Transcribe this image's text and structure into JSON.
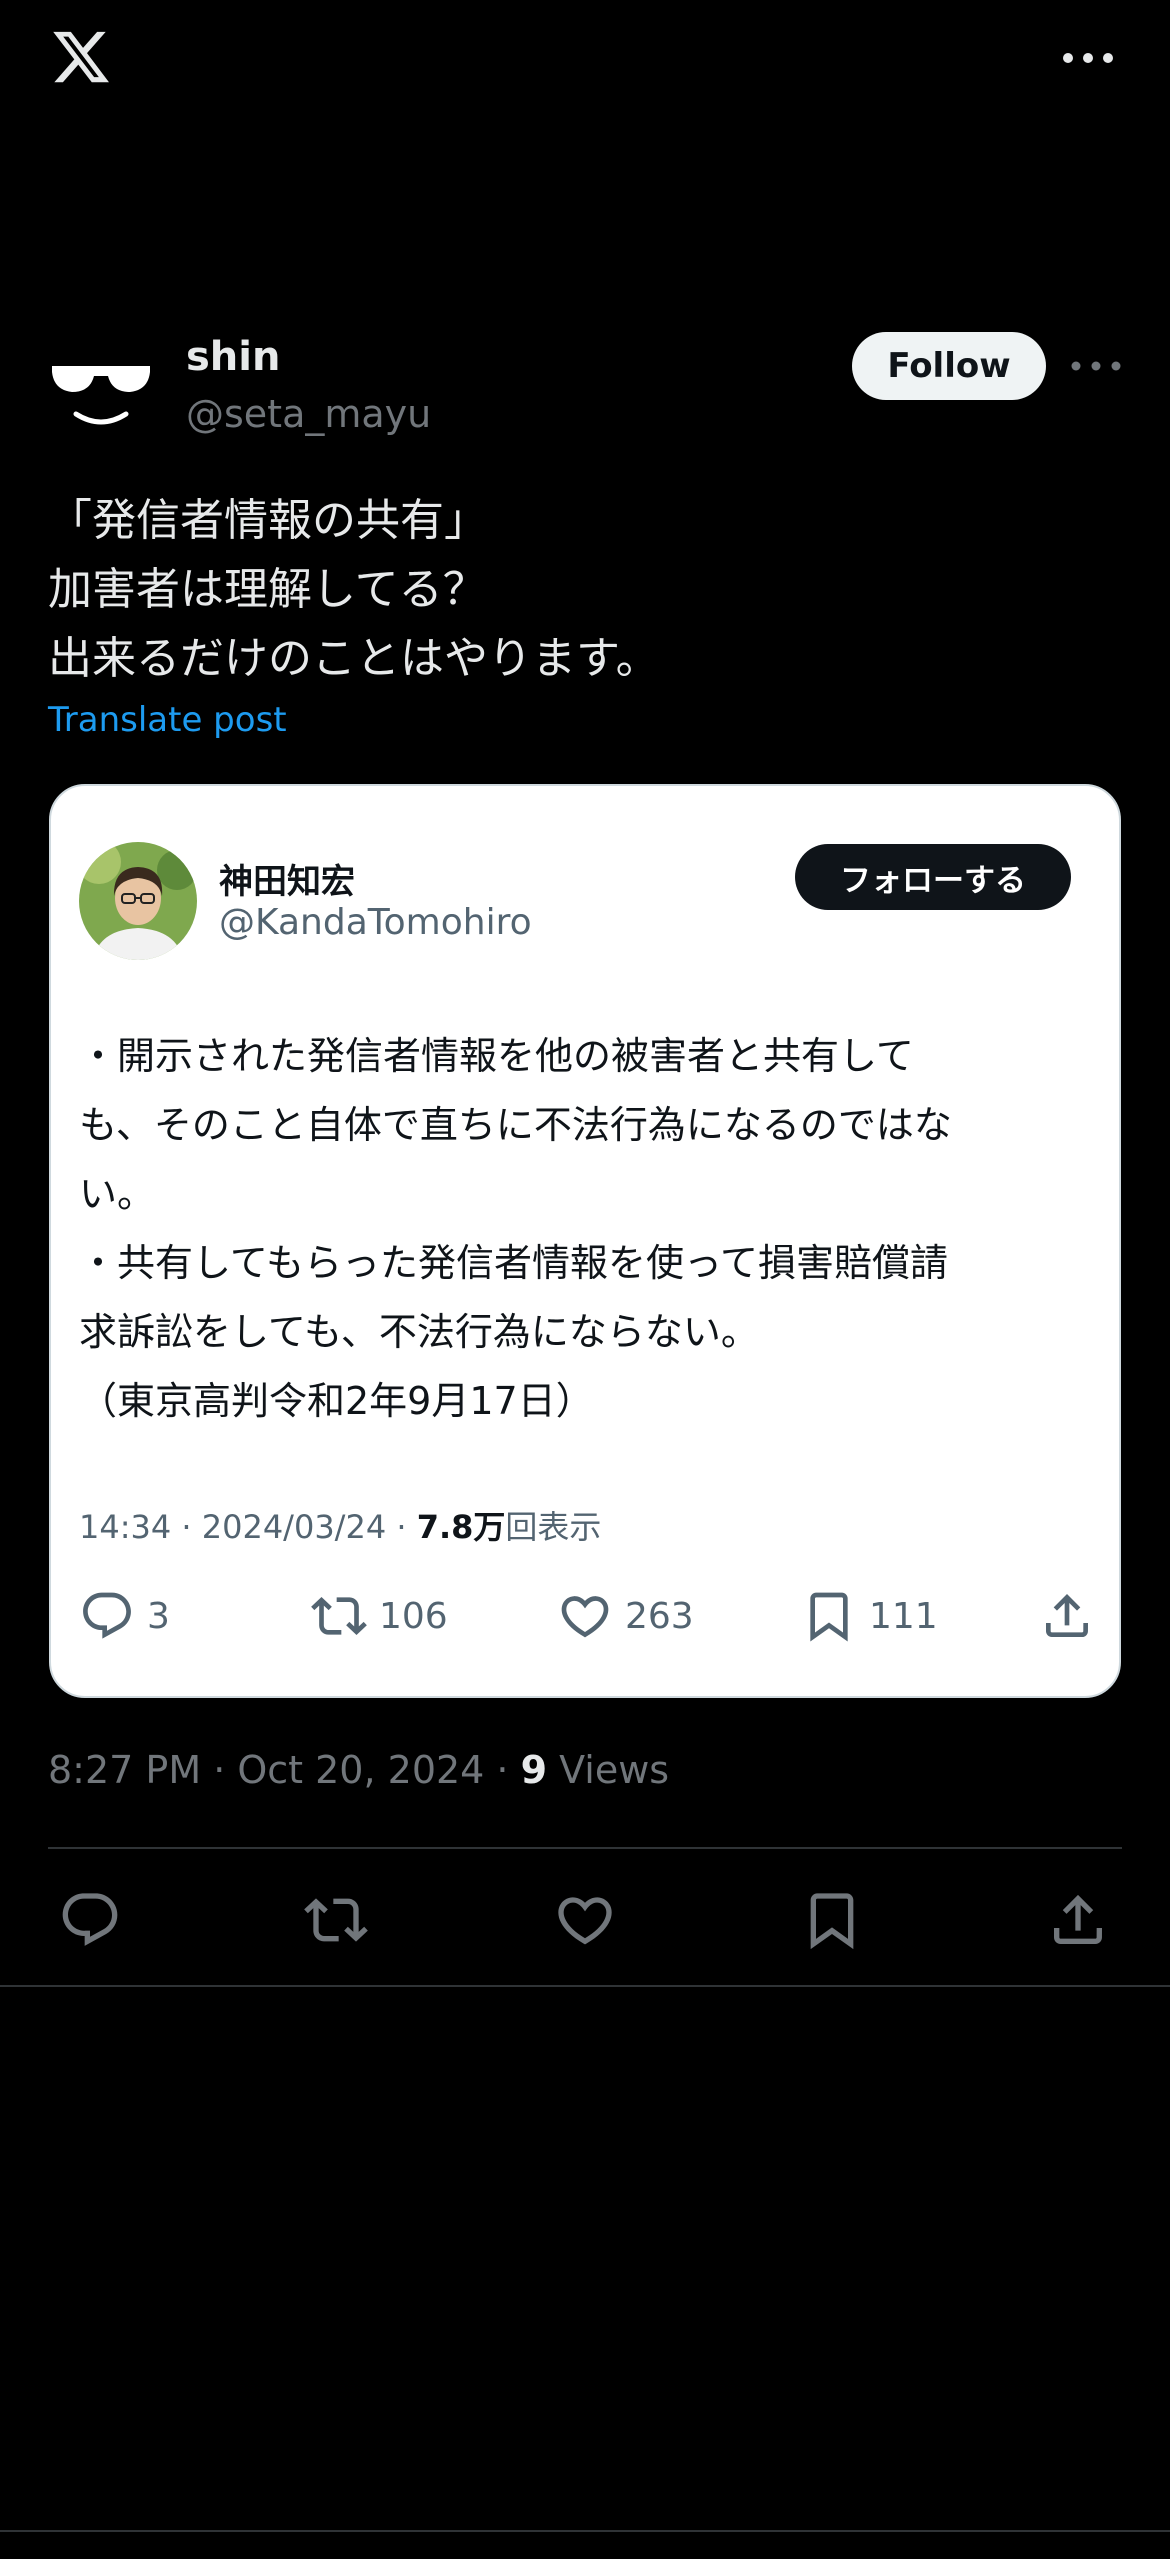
{
  "top_bar": {
    "logo_icon": "x-logo-icon",
    "more_icon": "more-horizontal-icon"
  },
  "author": {
    "display_name": "shin",
    "handle": "@seta_mayu",
    "follow_label": "Follow",
    "avatar_icon": "sunglasses-smile-avatar"
  },
  "post": {
    "lines": [
      "「発信者情報の共有」",
      "加害者は理解してる？",
      "出来るだけのことはやります。"
    ],
    "translate_label": "Translate post"
  },
  "quoted": {
    "display_name": "神田知宏",
    "handle": "@KandaTomohiro",
    "follow_label": "フォローする",
    "body_lines": [
      "・開示された発信者情報を他の被害者と共有して",
      "も、そのこと自体で直ちに不法行為になるのではな",
      "い。",
      "・共有してもらった発信者情報を使って損害賠償請",
      "求訴訟をしても、不法行為にならない。",
      "（東京高判令和2年9月17日）"
    ],
    "meta_time": "14:34 · 2024/03/24 · ",
    "meta_views_count": "7.8万",
    "meta_views_label": "回表示",
    "replies": "3",
    "reposts": "106",
    "likes": "263",
    "bookmarks": "111"
  },
  "timestamp": {
    "time": "8:27 PM · Oct 20, 2024 · ",
    "views_count": "9",
    "views_label": " Views"
  },
  "colors": {
    "background": "#000000",
    "accent": "#1d9bf0",
    "muted": "#71767b",
    "card_bg": "#ffffff"
  }
}
